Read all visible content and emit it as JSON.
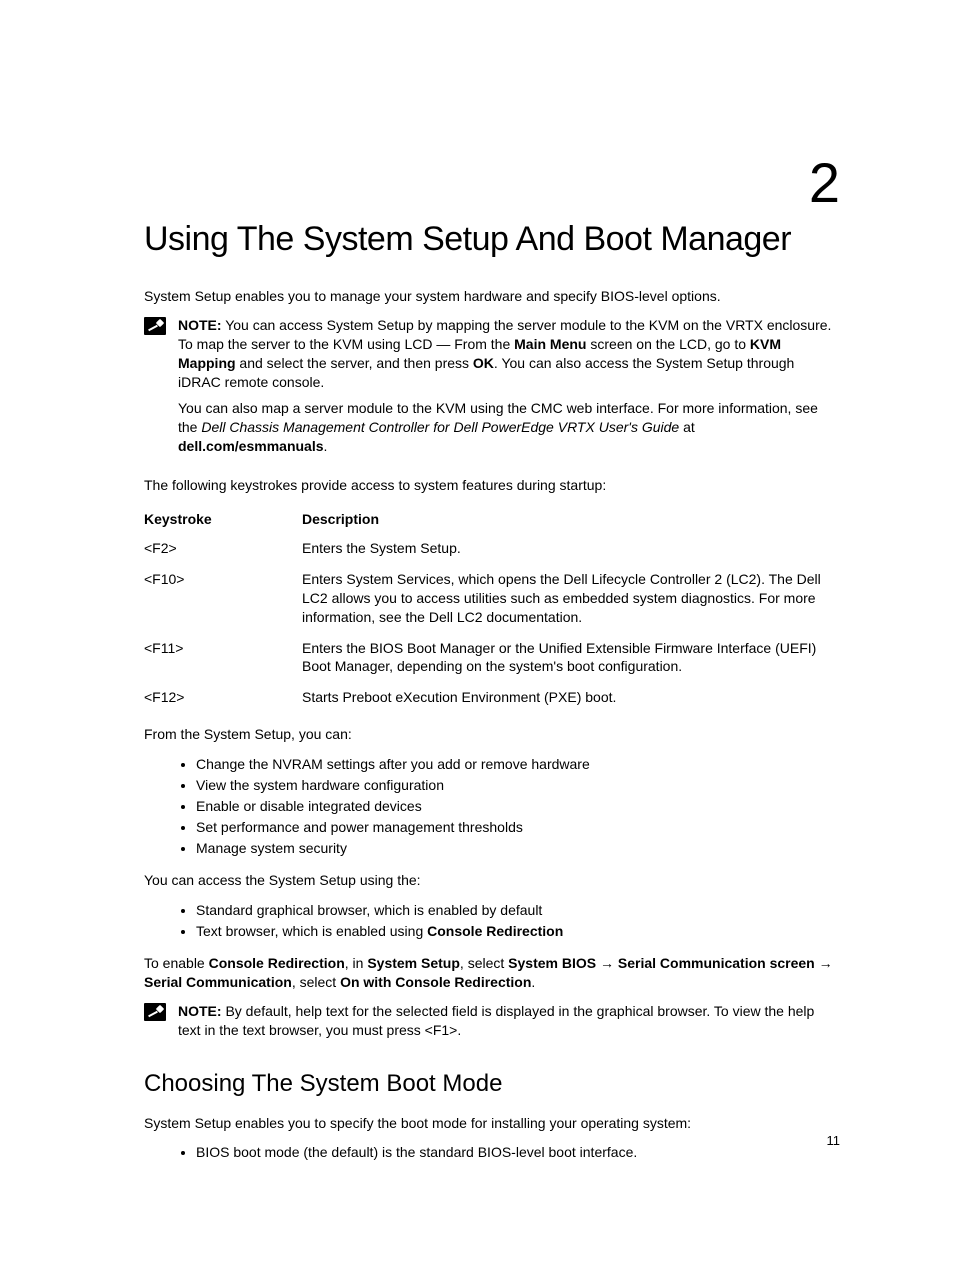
{
  "chapter_number": "2",
  "title": "Using The System Setup And Boot Manager",
  "intro": "System Setup enables you to manage your system hardware and specify BIOS-level options.",
  "note1": {
    "label": "NOTE:",
    "line1a": " You can access System Setup by mapping the server module to the KVM on the VRTX enclosure. To map the server to the KVM using LCD — From the ",
    "main_menu": "Main Menu",
    "line1b": " screen on the LCD, go to ",
    "kvm_mapping": "KVM Mapping",
    "line1c": " and select the server, and then press ",
    "ok": "OK",
    "line1d": ". You can also access the System Setup through iDRAC remote console.",
    "line2a": "You can also map a server module to the KVM using the CMC web interface. For more information, see the ",
    "doc_title": "Dell Chassis Management Controller for Dell PowerEdge VRTX User's Guide",
    "line2b": " at ",
    "url": "dell.com/esmmanuals",
    "period": "."
  },
  "keystrokes_intro": "The following keystrokes provide access to system features during startup:",
  "table": {
    "header_key": "Keystroke",
    "header_desc": "Description",
    "rows": [
      {
        "key": "<F2>",
        "desc": "Enters the System Setup."
      },
      {
        "key": "<F10>",
        "desc": "Enters System Services, which opens the Dell Lifecycle Controller 2 (LC2). The Dell LC2 allows you to access utilities such as embedded system diagnostics. For more information, see the Dell LC2 documentation."
      },
      {
        "key": "<F11>",
        "desc": "Enters the BIOS Boot Manager or the Unified Extensible Firmware Interface (UEFI) Boot Manager, depending on the system's boot configuration."
      },
      {
        "key": "<F12>",
        "desc": "Starts Preboot eXecution Environment (PXE) boot."
      }
    ]
  },
  "from_setup": "From the System Setup, you can:",
  "setup_bullets": [
    "Change the NVRAM settings after you add or remove hardware",
    "View the system hardware configuration",
    "Enable or disable integrated devices",
    "Set performance and power management thresholds",
    "Manage system security"
  ],
  "access_setup": "You can access the System Setup using the:",
  "access_bullets_plain": "Standard graphical browser, which is enabled by default",
  "access_bullet2_a": "Text browser, which is enabled using ",
  "access_bullet2_b": "Console Redirection",
  "enable": {
    "a": "To enable ",
    "console_redir": "Console Redirection",
    "b": ", in ",
    "system_setup": "System Setup",
    "c": ", select ",
    "system_bios": "System BIOS",
    "arrow1": " → ",
    "serial_screen": "Serial Communication screen",
    "arrow2": " → ",
    "serial_comm": "Serial Communication",
    "d": ", select ",
    "on_with": "On with Console Redirection",
    "period": "."
  },
  "note2": {
    "label": "NOTE:",
    "text": " By default, help text for the selected field is displayed in the graphical browser. To view the help text in the text browser, you must press <F1>."
  },
  "h2": "Choosing The System Boot Mode",
  "bootmode_intro": "System Setup enables you to specify the boot mode for installing your operating system:",
  "boot_bullet": "BIOS boot mode (the default) is the standard BIOS-level boot interface.",
  "page_number": "11"
}
